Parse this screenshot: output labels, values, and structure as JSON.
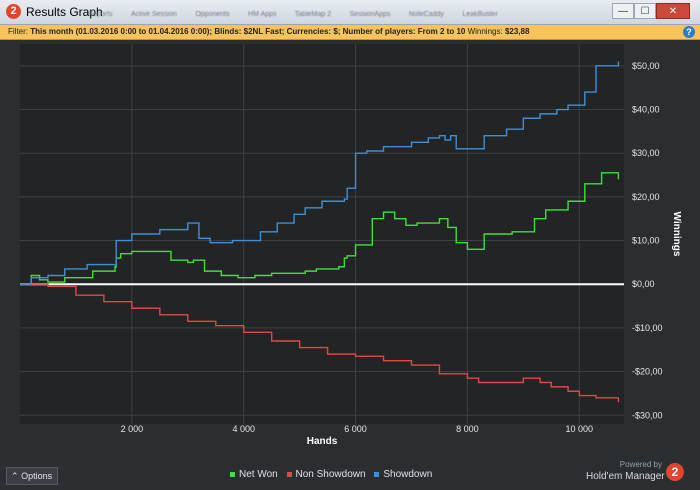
{
  "window": {
    "title": "Results Graph",
    "app_icon_text": "2",
    "background_tabs": [
      "Reports",
      "Active Session",
      "Opponents",
      "HM Apps",
      "TableMap 2",
      "SessionApps",
      "NoteCaddy",
      "LeakBuster"
    ],
    "btn_minimize": "—",
    "btn_maximize": "☐",
    "btn_close": "✕"
  },
  "filter_bar": {
    "prefix": "Filter:",
    "description": "This month (01.03.2016 0:00 to 01.04.2016 0:00); Blinds: $2NL Fast; Currencies: $; Number of players: From 2 to 10",
    "winnings_label": "Winnings:",
    "winnings_value": "$23,88",
    "help_icon_text": "?"
  },
  "options_button": {
    "icon": "⌃",
    "label": "Options"
  },
  "branding": {
    "powered": "Powered by",
    "product": "Hold'em Manager",
    "logo_text": "2"
  },
  "colors": {
    "plot_bg": "#222426",
    "grid": "#3c4044",
    "net_won": "#3fe03a",
    "non_showdown": "#e04848",
    "showdown": "#3f8fd6",
    "zero_line": "#ffffff"
  },
  "chart_data": {
    "type": "line",
    "xlabel": "Hands",
    "ylabel": "Winnings",
    "xlim": [
      0,
      10800
    ],
    "ylim": [
      -32,
      55
    ],
    "x_ticks": [
      2000,
      4000,
      6000,
      8000,
      10000
    ],
    "x_tick_labels": [
      "2 000",
      "4 000",
      "6 000",
      "8 000",
      "10 000"
    ],
    "y_ticks": [
      50,
      40,
      30,
      20,
      10,
      0,
      -10,
      -20,
      -30
    ],
    "y_tick_labels": [
      "$50,00",
      "$40,00",
      "$30,00",
      "$20,00",
      "$10,00",
      "$0,00",
      "-$10,00",
      "-$20,00",
      "-$30,00"
    ],
    "grid": true,
    "legend_position": "bottom",
    "series": [
      {
        "name": "Net Won",
        "color": "#3fe03a",
        "x": [
          0,
          200,
          350,
          500,
          800,
          1300,
          1700,
          1720,
          1800,
          2000,
          2600,
          2700,
          3000,
          3100,
          3300,
          3600,
          3900,
          4200,
          4500,
          4900,
          5100,
          5300,
          5700,
          5800,
          5850,
          6000,
          6300,
          6500,
          6700,
          6900,
          7100,
          7500,
          7650,
          7800,
          8000,
          8300,
          8600,
          8800,
          9200,
          9400,
          9800,
          10100,
          10400,
          10700
        ],
        "y": [
          0,
          2,
          1,
          0.5,
          1.5,
          3,
          4,
          6,
          7,
          7.5,
          7.5,
          5.5,
          5,
          5.5,
          3,
          2,
          1.5,
          2,
          2.5,
          2.5,
          3,
          3.5,
          4,
          6,
          6.5,
          9,
          15,
          16.5,
          15,
          13.5,
          14,
          15,
          13,
          9.5,
          8,
          11.5,
          11.5,
          12,
          15,
          17,
          19,
          23,
          25.5,
          24
        ]
      },
      {
        "name": "Non Showdown",
        "color": "#e04848",
        "x": [
          0,
          500,
          1000,
          1500,
          2000,
          2500,
          3000,
          3500,
          4000,
          4500,
          5000,
          5500,
          6000,
          6500,
          7000,
          7500,
          8000,
          8200,
          8500,
          8800,
          9000,
          9300,
          9500,
          9800,
          10000,
          10300,
          10700
        ],
        "y": [
          0,
          -0.5,
          -2.5,
          -4,
          -5.5,
          -7,
          -8.5,
          -9.5,
          -11,
          -13,
          -14.5,
          -16,
          -16.5,
          -17.5,
          -18.5,
          -20.5,
          -21.5,
          -22.5,
          -22.5,
          -22.5,
          -21.5,
          -22.5,
          -23.5,
          -24.5,
          -25.5,
          -26,
          -27
        ]
      },
      {
        "name": "Showdown",
        "color": "#3f8fd6",
        "x": [
          0,
          200,
          500,
          800,
          1200,
          1700,
          1720,
          2000,
          2500,
          2700,
          3000,
          3200,
          3400,
          3800,
          4300,
          4600,
          4900,
          5100,
          5400,
          5800,
          5850,
          6000,
          6200,
          6500,
          7000,
          7300,
          7500,
          7600,
          7700,
          7800,
          8000,
          8300,
          8700,
          9000,
          9300,
          9600,
          9800,
          10100,
          10300,
          10700
        ],
        "y": [
          0,
          1.5,
          2,
          3.5,
          4.5,
          4.5,
          10,
          11.5,
          12.5,
          12.5,
          14,
          10.5,
          9.5,
          10,
          12,
          14,
          16,
          17.5,
          19,
          19.5,
          22,
          30,
          30.5,
          31.5,
          32.5,
          33.5,
          34,
          33,
          34,
          31,
          31,
          34,
          35.5,
          38,
          39,
          40,
          41,
          44,
          50,
          51
        ]
      }
    ]
  }
}
